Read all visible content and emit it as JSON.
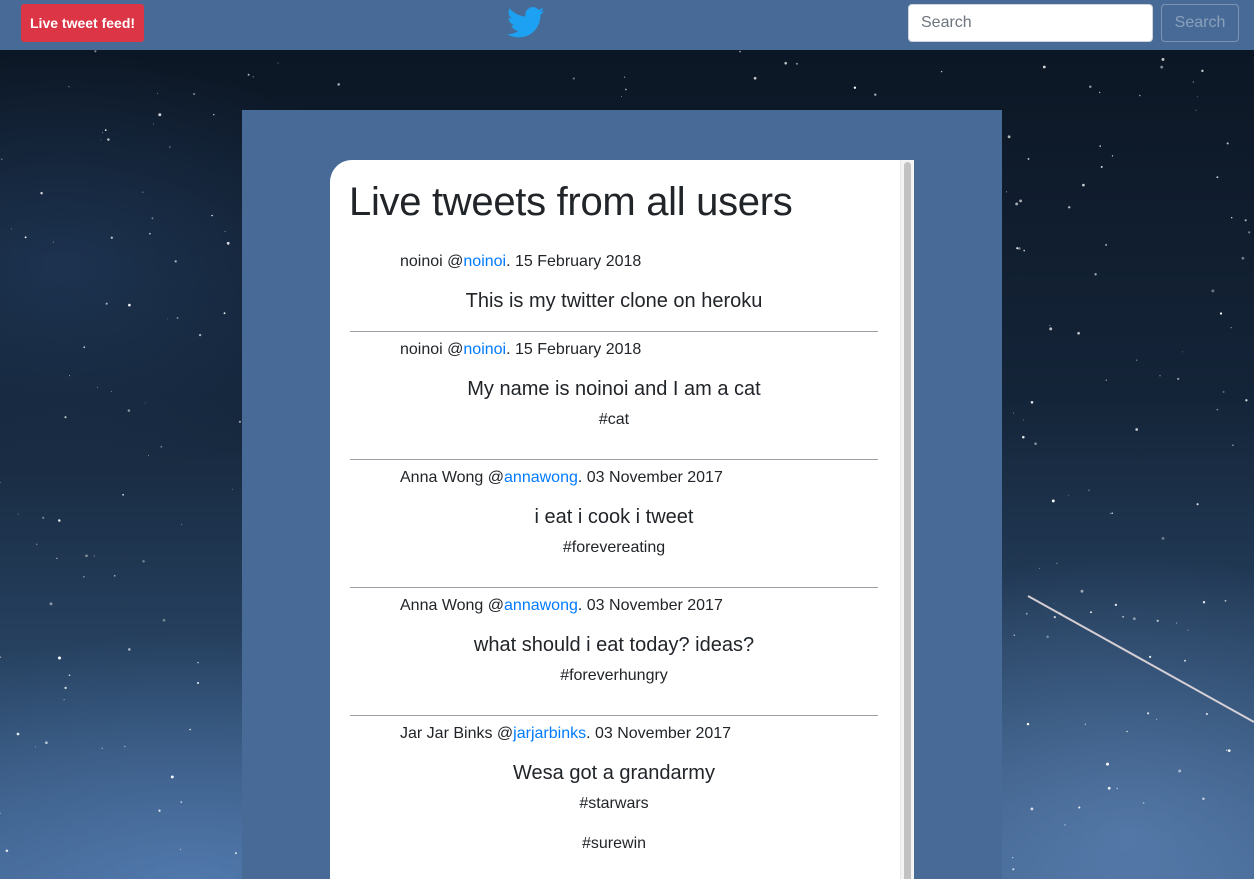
{
  "navbar": {
    "live_button": "Live tweet feed!",
    "logo": "twitter-bird-icon",
    "search": {
      "placeholder": "Search",
      "button_label": "Search"
    }
  },
  "colors": {
    "navbar": "#476b96",
    "live_button": "#dc3545",
    "link": "#007bff",
    "logo": "#1da1f2"
  },
  "feed": {
    "title": "Live tweets from all users",
    "tweets": [
      {
        "name": "noinoi",
        "at": "@",
        "handle": "noinoi",
        "date": ". 15 February 2018",
        "text": "This is my twitter clone on heroku",
        "tags": []
      },
      {
        "name": "noinoi",
        "at": "@",
        "handle": "noinoi",
        "date": ". 15 February 2018",
        "text": "My name is noinoi and I am a cat",
        "tags": [
          "#cat"
        ]
      },
      {
        "name": "Anna Wong",
        "at": "@",
        "handle": "annawong",
        "date": ". 03 November 2017",
        "text": "i eat i cook i tweet",
        "tags": [
          "#forevereating"
        ]
      },
      {
        "name": "Anna Wong",
        "at": "@",
        "handle": "annawong",
        "date": ". 03 November 2017",
        "text": "what should i eat today? ideas?",
        "tags": [
          "#foreverhungry"
        ]
      },
      {
        "name": "Jar Jar Binks",
        "at": "@",
        "handle": "jarjarbinks",
        "date": ". 03 November 2017",
        "text": "Wesa got a grandarmy",
        "tags": [
          "#starwars",
          "#surewin"
        ]
      }
    ]
  }
}
